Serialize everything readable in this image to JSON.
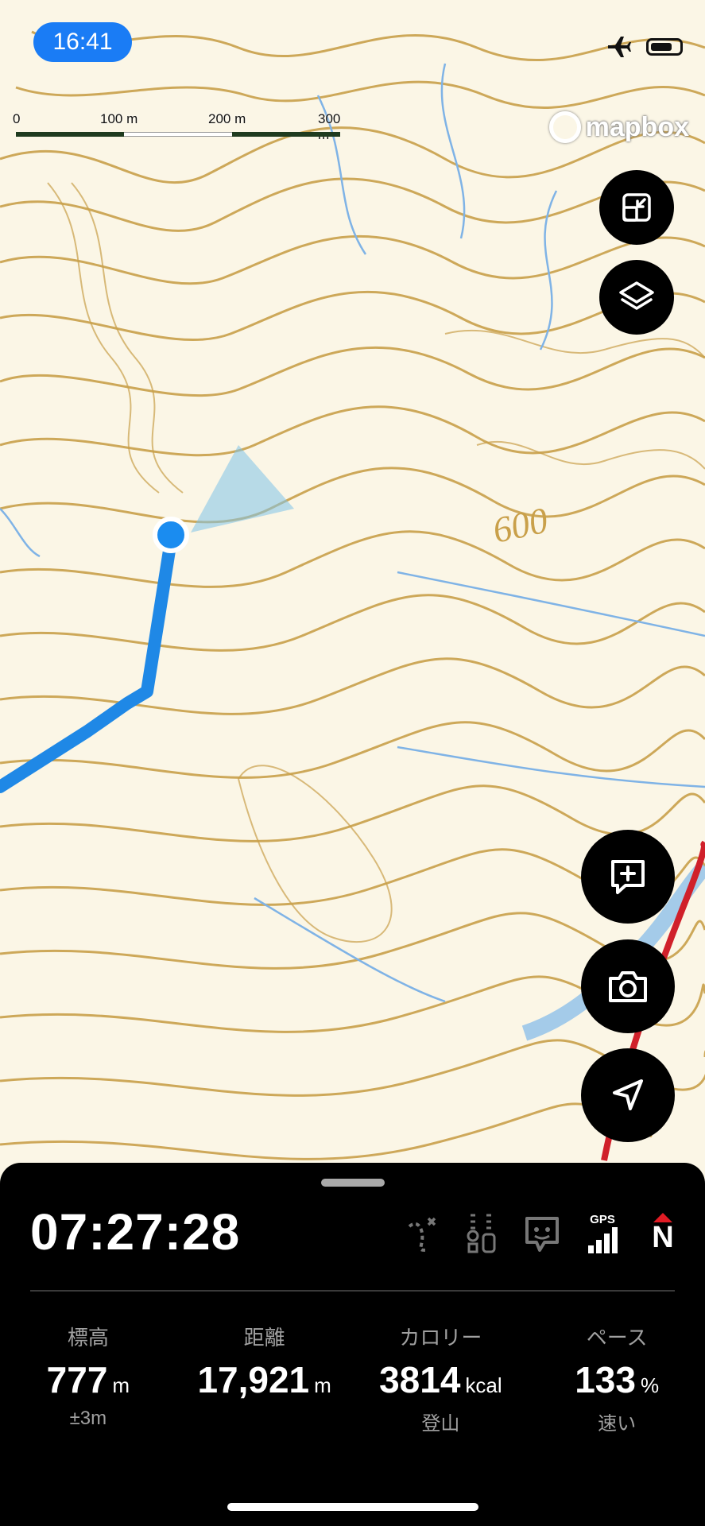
{
  "status": {
    "time": "16:41"
  },
  "map": {
    "scale_labels": [
      "0",
      "100 m",
      "200 m",
      "300 m"
    ],
    "contour_label": "600",
    "attribution": "mapbox"
  },
  "buttons": {
    "collapse": "collapse-icon",
    "layers": "layers-icon",
    "add_memo": "add-note-icon",
    "camera": "camera-icon",
    "locate": "navigate-icon"
  },
  "panel": {
    "elapsed": "07:27:28",
    "gps_label": "GPS",
    "compass_label": "N",
    "stats": [
      {
        "label": "標高",
        "value": "777",
        "unit": "m",
        "sub": "±3m"
      },
      {
        "label": "距離",
        "value": "17,921",
        "unit": "m",
        "sub": ""
      },
      {
        "label": "カロリー",
        "value": "3814",
        "unit": "kcal",
        "sub": "登山"
      },
      {
        "label": "ペース",
        "value": "133",
        "unit": "%",
        "sub": "速い"
      }
    ]
  },
  "colors": {
    "accent": "#1a7cf5",
    "contour": "#c9a04a",
    "stream": "#7fb3e6",
    "track": "#2b8fe6",
    "route": "#d0202a"
  }
}
